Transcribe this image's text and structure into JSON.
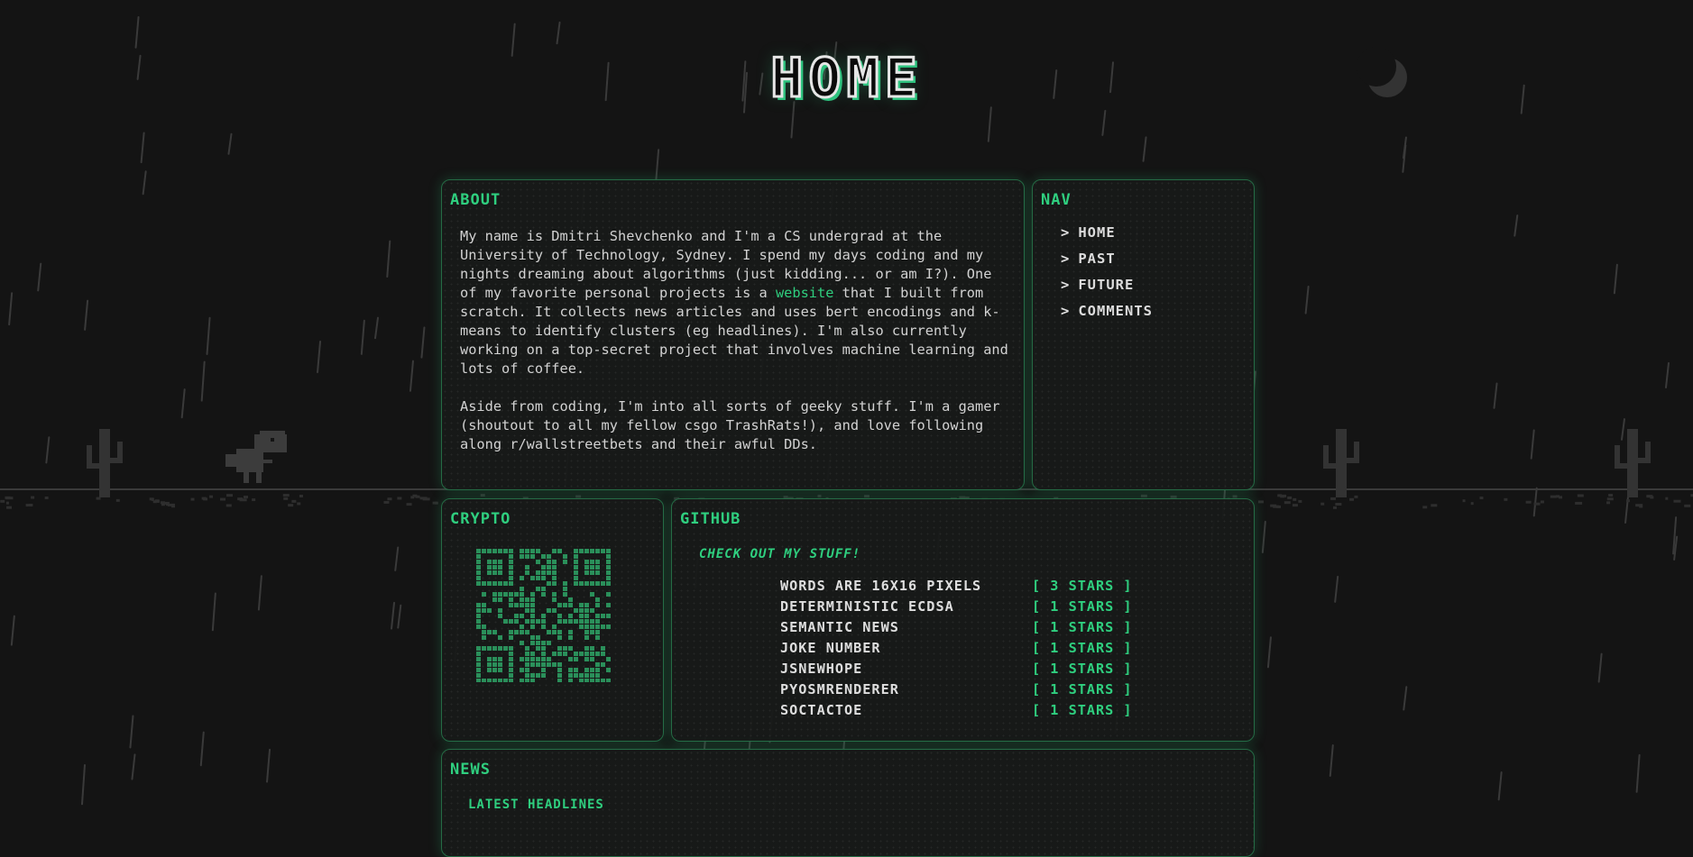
{
  "page": {
    "title": "HOME"
  },
  "colors": {
    "accent": "#2fcf7f",
    "background": "#141414",
    "panel_border": "#256b45"
  },
  "about": {
    "title": "ABOUT",
    "para1_before_link": "My name is Dmitri Shevchenko and I'm a CS undergrad at the University of Technology, Sydney. I spend my days coding and my nights dreaming about algorithms (just kidding... or am I?). One of my favorite personal projects is a ",
    "link_text": "website",
    "para1_after_link": " that I built from scratch. It collects news articles and uses bert encodings and k-means to identify clusters (eg headlines). I'm also currently working on a top-secret project that involves machine learning and lots of coffee.",
    "para2": "Aside from coding, I'm into all sorts of geeky stuff. I'm a gamer (shoutout to all my fellow csgo TrashRats!), and love following along r/wallstreetbets and their awful DDs."
  },
  "nav": {
    "title": "NAV",
    "arrow": ">",
    "items": [
      {
        "label": "HOME"
      },
      {
        "label": "PAST"
      },
      {
        "label": "FUTURE"
      },
      {
        "label": "COMMENTS"
      }
    ]
  },
  "crypto": {
    "title": "CRYPTO",
    "qr_icon": "qr-code-icon"
  },
  "github": {
    "title": "GITHUB",
    "subtitle": "CHECK OUT MY STUFF!",
    "repos": [
      {
        "name": "WORDS ARE 16X16 PIXELS",
        "stars": "[ 3 STARS ]"
      },
      {
        "name": "DETERMINISTIC ECDSA",
        "stars": "[ 1 STARS ]"
      },
      {
        "name": "SEMANTIC NEWS",
        "stars": "[ 1 STARS ]"
      },
      {
        "name": "JOKE NUMBER",
        "stars": "[ 1 STARS ]"
      },
      {
        "name": "JSNEWHOPE",
        "stars": "[ 1 STARS ]"
      },
      {
        "name": "PYOSMRENDERER",
        "stars": "[ 1 STARS ]"
      },
      {
        "name": "SOCTACTOE",
        "stars": "[ 1 STARS ]"
      }
    ]
  },
  "news": {
    "title": "NEWS",
    "subtitle": "LATEST HEADLINES"
  }
}
